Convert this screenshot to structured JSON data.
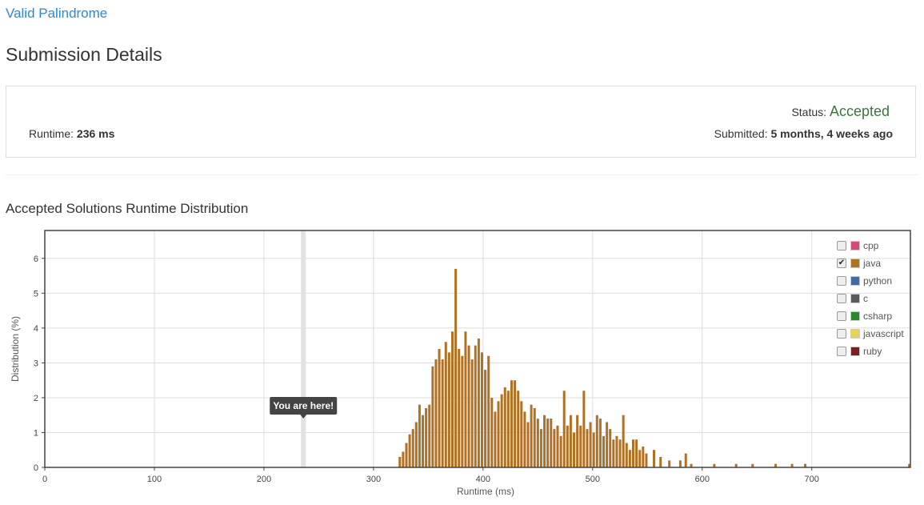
{
  "header": {
    "problem_link": "Valid Palindrome",
    "page_title": "Submission Details"
  },
  "details": {
    "status_label": "Status:",
    "status_value": "Accepted",
    "runtime_label": "Runtime:",
    "runtime_value": "236 ms",
    "submitted_label": "Submitted:",
    "submitted_value": "5 months, 4 weeks ago"
  },
  "section_title": "Accepted Solutions Runtime Distribution",
  "legend": [
    {
      "name": "cpp",
      "color": "#d9477b",
      "checked": false
    },
    {
      "name": "java",
      "color": "#b17124",
      "checked": true
    },
    {
      "name": "python",
      "color": "#3e6ea8",
      "checked": false
    },
    {
      "name": "c",
      "color": "#5a5a5a",
      "checked": false
    },
    {
      "name": "csharp",
      "color": "#2a8a2a",
      "checked": false
    },
    {
      "name": "javascript",
      "color": "#e8d35a",
      "checked": false
    },
    {
      "name": "ruby",
      "color": "#7a1f1f",
      "checked": false
    }
  ],
  "chart_data": {
    "type": "bar",
    "xlabel": "Runtime (ms)",
    "ylabel": "Distribution (%)",
    "xlim": [
      0,
      790
    ],
    "ylim": [
      0,
      6.8
    ],
    "x_ticks": [
      0,
      100,
      200,
      300,
      400,
      500,
      600,
      700
    ],
    "y_ticks": [
      0,
      1,
      2,
      3,
      4,
      5,
      6
    ],
    "grid": true,
    "highlight_x": 236,
    "annotation": "You are here!",
    "series": [
      {
        "name": "java",
        "color": "#b17124",
        "x": [
          324,
          327,
          330,
          333,
          336,
          339,
          342,
          345,
          348,
          351,
          354,
          357,
          360,
          363,
          366,
          369,
          372,
          375,
          378,
          381,
          384,
          387,
          390,
          393,
          396,
          399,
          402,
          405,
          408,
          411,
          414,
          417,
          420,
          423,
          426,
          429,
          432,
          435,
          438,
          441,
          444,
          447,
          450,
          453,
          456,
          459,
          462,
          465,
          468,
          471,
          474,
          477,
          480,
          483,
          486,
          489,
          492,
          495,
          498,
          501,
          504,
          507,
          510,
          513,
          516,
          519,
          522,
          525,
          528,
          531,
          534,
          537,
          540,
          543,
          546,
          549,
          556,
          562,
          570,
          580,
          585,
          590,
          611,
          631,
          646,
          667,
          682,
          694,
          789
        ],
        "values": [
          0.3,
          0.45,
          0.7,
          0.95,
          1.1,
          1.3,
          1.8,
          1.5,
          1.7,
          1.8,
          2.9,
          3.1,
          3.4,
          3.1,
          3.6,
          3.3,
          3.9,
          5.7,
          3.4,
          3.2,
          3.9,
          3.5,
          3.1,
          3.5,
          3.7,
          3.3,
          2.8,
          3.2,
          2.0,
          1.6,
          1.9,
          2.1,
          2.3,
          2.2,
          2.5,
          2.5,
          2.2,
          1.9,
          1.6,
          1.3,
          1.8,
          1.7,
          1.4,
          1.1,
          1.5,
          1.4,
          1.4,
          1.1,
          1.2,
          0.9,
          2.2,
          1.2,
          1.5,
          1.0,
          1.5,
          1.2,
          2.2,
          1.1,
          1.3,
          1.0,
          1.5,
          1.4,
          0.9,
          1.3,
          1.1,
          0.8,
          0.9,
          0.8,
          1.5,
          0.7,
          0.5,
          0.8,
          0.8,
          0.5,
          0.6,
          0.4,
          0.5,
          0.3,
          0.2,
          0.2,
          0.4,
          0.1,
          0.1,
          0.1,
          0.1,
          0.1,
          0.1,
          0.1,
          0.1
        ]
      }
    ]
  }
}
